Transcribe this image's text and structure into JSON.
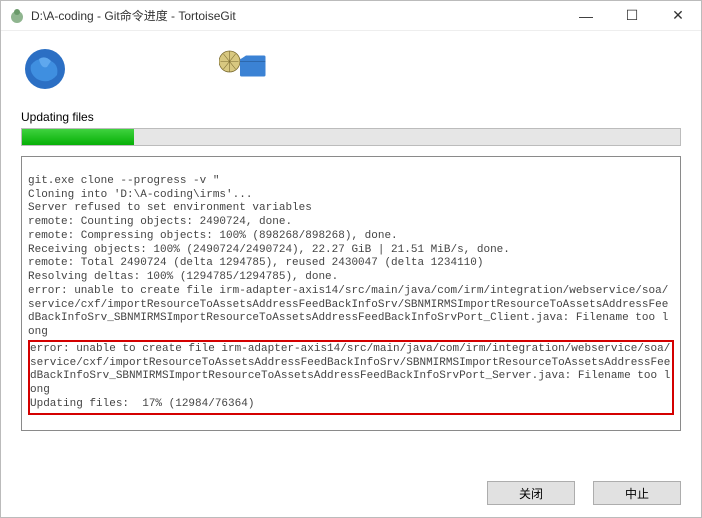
{
  "window": {
    "title": "D:\\A-coding - Git命令进度 - TortoiseGit",
    "minimize": "—",
    "maximize": "☐",
    "close": "✕"
  },
  "status": {
    "label": "Updating files"
  },
  "progress": {
    "percent": 17
  },
  "log": {
    "lines": [
      "git.exe clone --progress -v \"",
      "Cloning into 'D:\\A-coding\\irms'...",
      "Server refused to set environment variables",
      "remote: Counting objects: 2490724, done.",
      "remote: Compressing objects: 100% (898268/898268), done.",
      "Receiving objects: 100% (2490724/2490724), 22.27 GiB | 21.51 MiB/s, done.",
      "remote: Total 2490724 (delta 1294785), reused 2430047 (delta 1234110)",
      "Resolving deltas: 100% (1294785/1294785), done.",
      "error: unable to create file irm-adapter-axis14/src/main/java/com/irm/integration/webservice/soa/service/cxf/importResourceToAssetsAddressFeedBackInfoSrv/SBNMIRMSImportResourceToAssetsAddressFeedBackInfoSrv_SBNMIRMSImportResourceToAssetsAddressFeedBackInfoSrvPort_Client.java: Filename too long"
    ],
    "highlighted": [
      "error: unable to create file irm-adapter-axis14/src/main/java/com/irm/integration/webservice/soa/service/cxf/importResourceToAssetsAddressFeedBackInfoSrv/SBNMIRMSImportResourceToAssetsAddressFeedBackInfoSrv_SBNMIRMSImportResourceToAssetsAddressFeedBackInfoSrvPort_Server.java: Filename too long",
      "Updating files:  17% (12984/76364)"
    ]
  },
  "buttons": {
    "close": "关闭",
    "abort": "中止"
  }
}
